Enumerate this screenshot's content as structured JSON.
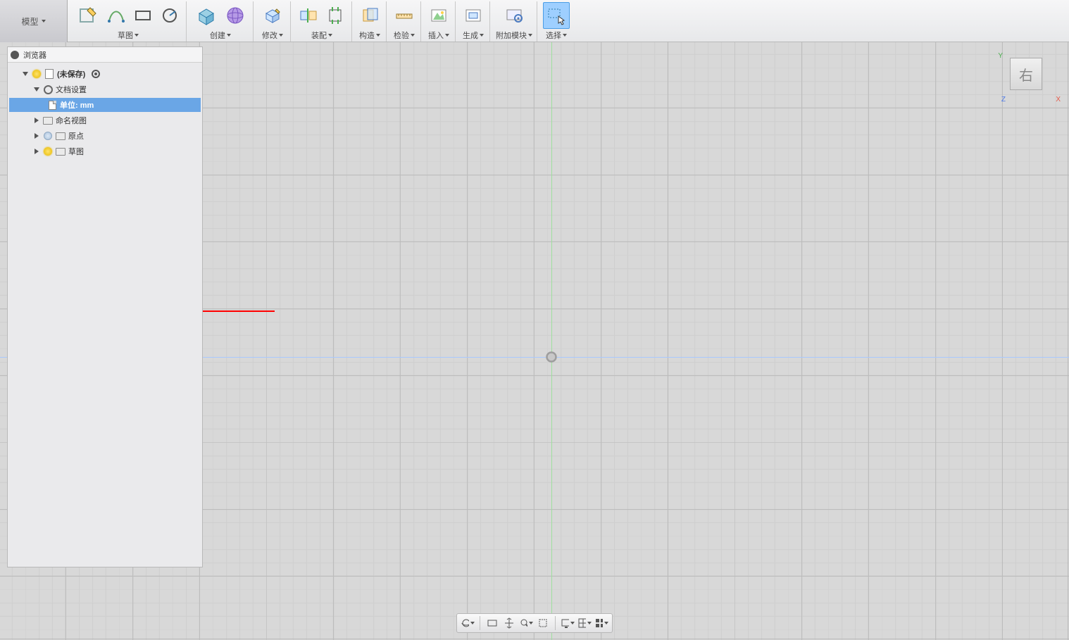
{
  "workspace_label": "模型",
  "toolbar_groups": [
    {
      "label": "草图"
    },
    {
      "label": "创建"
    },
    {
      "label": "修改"
    },
    {
      "label": "装配"
    },
    {
      "label": "构造"
    },
    {
      "label": "检验"
    },
    {
      "label": "插入"
    },
    {
      "label": "生成"
    },
    {
      "label": "附加模块"
    },
    {
      "label": "选择"
    }
  ],
  "browser_title": "浏览器",
  "tree": {
    "root_label": "(未保存)",
    "doc_settings": "文档设置",
    "units_label": "单位: mm",
    "named_views": "命名视图",
    "origin": "原点",
    "sketches": "草图"
  },
  "viewcube_face": "右",
  "axis_labels": {
    "x": "X",
    "y": "Y",
    "z": "Z"
  },
  "nav_tooltips": {
    "orbit": "orbit",
    "lookat": "lookat",
    "pan": "pan",
    "zoom": "zoom",
    "fit": "fit",
    "display": "display",
    "grid": "grid",
    "viewports": "viewports"
  }
}
